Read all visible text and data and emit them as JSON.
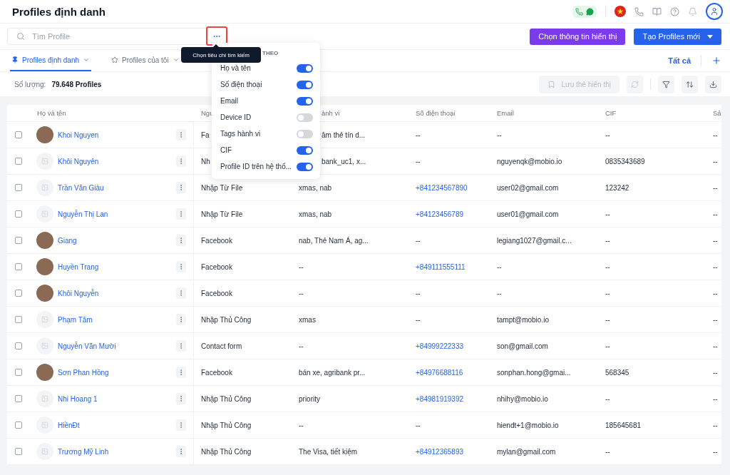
{
  "header": {
    "title": "Profiles định danh"
  },
  "search": {
    "placeholder": "Tìm Profile",
    "criteria_button_highlighted": true
  },
  "actions": [
    {
      "label": "Chọn thông tin hiển thị",
      "kind": "secondary"
    },
    {
      "label": "Tạo Profiles mới",
      "kind": "primary"
    }
  ],
  "tabs": [
    {
      "label": "Profiles định danh",
      "selected": true
    },
    {
      "label": "Profiles của tôi",
      "selected": false
    }
  ],
  "all_link": "Tất cả",
  "summary": {
    "label": "Số lượng:",
    "value": "79.648 Profiles"
  },
  "save_view": {
    "label": "Lưu thẻ hiển thị",
    "disabled": true
  },
  "table": {
    "columns": [
      {
        "label": "Họ và tên",
        "cut_start": false
      },
      {
        "label": "Ngu",
        "cut_start": false
      },
      {
        "label": "ành vi",
        "cut_start": true
      },
      {
        "label": "Số điện thoại",
        "cut_start": false
      },
      {
        "label": "Email",
        "cut_start": false
      },
      {
        "label": "CIF",
        "cut_start": false
      },
      {
        "label": "Sả",
        "cut_start": false
      }
    ],
    "rows": [
      {
        "checked": false,
        "has_photo": true,
        "name": "Khoi Nguyen",
        "source": "Fa",
        "tags": "âm thẻ tín d...",
        "tags_cut": true,
        "phone": "--",
        "phone_linked": false,
        "email": "--",
        "cif": "--",
        "column_7": "--"
      },
      {
        "checked": false,
        "has_photo": false,
        "name": "Khôi Nguyên",
        "source": "Nh",
        "tags": "bank_uc1, x...",
        "tags_cut": true,
        "phone": "--",
        "phone_linked": false,
        "email": "nguyenqk@mobio.io",
        "cif": "0835343689",
        "column_7": "--"
      },
      {
        "checked": false,
        "has_photo": false,
        "name": "Trần Văn Giàu",
        "source": "Nhập Từ File",
        "tags": "xmas, nab",
        "tags_cut": false,
        "phone": "+841234567890",
        "phone_linked": true,
        "email": "user02@gmail.com",
        "cif": "123242",
        "column_7": "--"
      },
      {
        "checked": false,
        "has_photo": false,
        "name": "Nguyễn Thị Lan",
        "source": "Nhập Từ File",
        "tags": "xmas, nab",
        "tags_cut": false,
        "phone": "+84123456789",
        "phone_linked": true,
        "email": "user01@gmail.com",
        "cif": "--",
        "column_7": "--"
      },
      {
        "checked": false,
        "has_photo": true,
        "name": "Giang",
        "source": "Facebook",
        "tags": "nab, Thẻ Nam Á, ag...",
        "tags_cut": false,
        "phone": "--",
        "phone_linked": false,
        "email": "legiang1027@gmail.c...",
        "cif": "--",
        "column_7": "--"
      },
      {
        "checked": false,
        "has_photo": true,
        "name": "Huyền Trang",
        "source": "Facebook",
        "tags": "--",
        "tags_cut": false,
        "phone": "+849111555111",
        "phone_linked": true,
        "email": "--",
        "cif": "--",
        "column_7": "--"
      },
      {
        "checked": false,
        "has_photo": true,
        "name": "Khôi Nguyễn",
        "source": "Facebook",
        "tags": "--",
        "tags_cut": false,
        "phone": "--",
        "phone_linked": false,
        "email": "--",
        "cif": "--",
        "column_7": "--"
      },
      {
        "checked": false,
        "has_photo": false,
        "name": "Phạm Tâm",
        "source": "Nhập Thủ Công",
        "tags": "xmas",
        "tags_cut": false,
        "phone": "--",
        "phone_linked": false,
        "email": "tampt@mobio.io",
        "cif": "--",
        "column_7": "--"
      },
      {
        "checked": false,
        "has_photo": false,
        "name": "Nguyễn Văn Mười",
        "source": "Contact form",
        "tags": "--",
        "tags_cut": false,
        "phone": "+84999222333",
        "phone_linked": true,
        "email": "son@gmail.com",
        "cif": "--",
        "column_7": "--"
      },
      {
        "checked": false,
        "has_photo": true,
        "name": "Sơn Phan Hồng",
        "source": "Facebook",
        "tags": "bán xe, agribank pr...",
        "tags_cut": false,
        "phone": "+84976688116",
        "phone_linked": true,
        "email": "sonphan.hong@gmai...",
        "cif": "568345",
        "column_7": "--"
      },
      {
        "checked": false,
        "has_photo": false,
        "name": "Nhi Hoang 1",
        "source": "Nhập Thủ Công",
        "tags": "priority",
        "tags_cut": false,
        "phone": "+84981919392",
        "phone_linked": true,
        "email": "nhihy@mobio.io",
        "cif": "--",
        "column_7": "--"
      },
      {
        "checked": false,
        "has_photo": false,
        "name": "HiềnĐt",
        "source": "Nhập Thủ Công",
        "tags": "--",
        "tags_cut": false,
        "phone": "--",
        "phone_linked": false,
        "email": "hiendt+1@mobio.io",
        "cif": "185645681",
        "column_7": "--"
      },
      {
        "checked": false,
        "has_photo": false,
        "name": "Trương Mỹ Linh",
        "source": "Nhập Thủ Công",
        "tags": "The Visa, tiết kiệm",
        "tags_cut": false,
        "phone": "+84912365893",
        "phone_linked": true,
        "email": "mylan@gmail.com",
        "cif": "--",
        "column_7": "--"
      }
    ]
  },
  "tooltip": {
    "text": "Chọn tiêu chí tìm kiếm"
  },
  "criteria_menu": {
    "heading": "THEO",
    "options": [
      {
        "label": "Họ và tên",
        "on": true
      },
      {
        "label": "Số điện thoại",
        "on": true
      },
      {
        "label": "Email",
        "on": true
      },
      {
        "label": "Device ID",
        "on": false
      },
      {
        "label": "Tags hành vi",
        "on": false
      },
      {
        "label": "CIF",
        "on": true
      },
      {
        "label": "Profile ID trên hệ thố...",
        "on": true
      }
    ]
  }
}
